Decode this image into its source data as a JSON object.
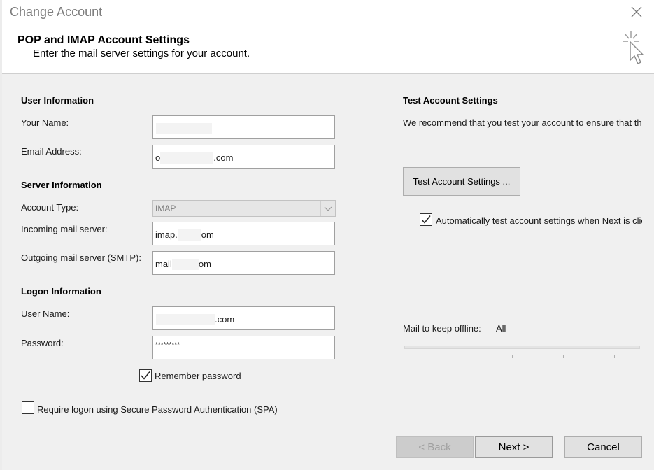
{
  "window": {
    "title": "Change Account"
  },
  "header": {
    "title": "POP and IMAP Account Settings",
    "subtitle": "Enter the mail server settings for your account."
  },
  "user_information": {
    "heading": "User Information",
    "your_name_label": "Your Name:",
    "your_name_value": "",
    "email_label": "Email Address:",
    "email_prefix": "o",
    "email_suffix": ".com"
  },
  "server_information": {
    "heading": "Server Information",
    "account_type_label": "Account Type:",
    "account_type_value": "IMAP",
    "incoming_label": "Incoming mail server:",
    "incoming_prefix": "imap.",
    "incoming_suffix": "om",
    "outgoing_label": "Outgoing mail server (SMTP):",
    "outgoing_prefix": "mail",
    "outgoing_suffix": "om"
  },
  "logon_information": {
    "heading": "Logon Information",
    "user_name_label": "User Name:",
    "user_name_suffix": ".com",
    "password_label": "Password:",
    "password_value": "*********",
    "remember_password_label": "Remember password",
    "remember_password_checked": true,
    "spa_label": "Require logon using Secure Password Authentication (SPA)",
    "spa_checked": false
  },
  "test_settings": {
    "heading": "Test Account Settings",
    "description": "We recommend that you test your account to ensure that th",
    "test_button_label": "Test Account Settings ...",
    "auto_test_label": "Automatically test account settings when Next is clic",
    "auto_test_checked": true
  },
  "offline": {
    "label": "Mail to keep offline:",
    "value": "All"
  },
  "footer": {
    "back_label": "< Back",
    "next_label": "Next >",
    "cancel_label": "Cancel"
  },
  "colors": {
    "dialog_background": "#f0f0f0",
    "field_border": "#a0a0a0",
    "button_background": "#e1e1e1",
    "disabled_text": "#a0a0a0",
    "primary_button_border": "#9a9a9a"
  }
}
